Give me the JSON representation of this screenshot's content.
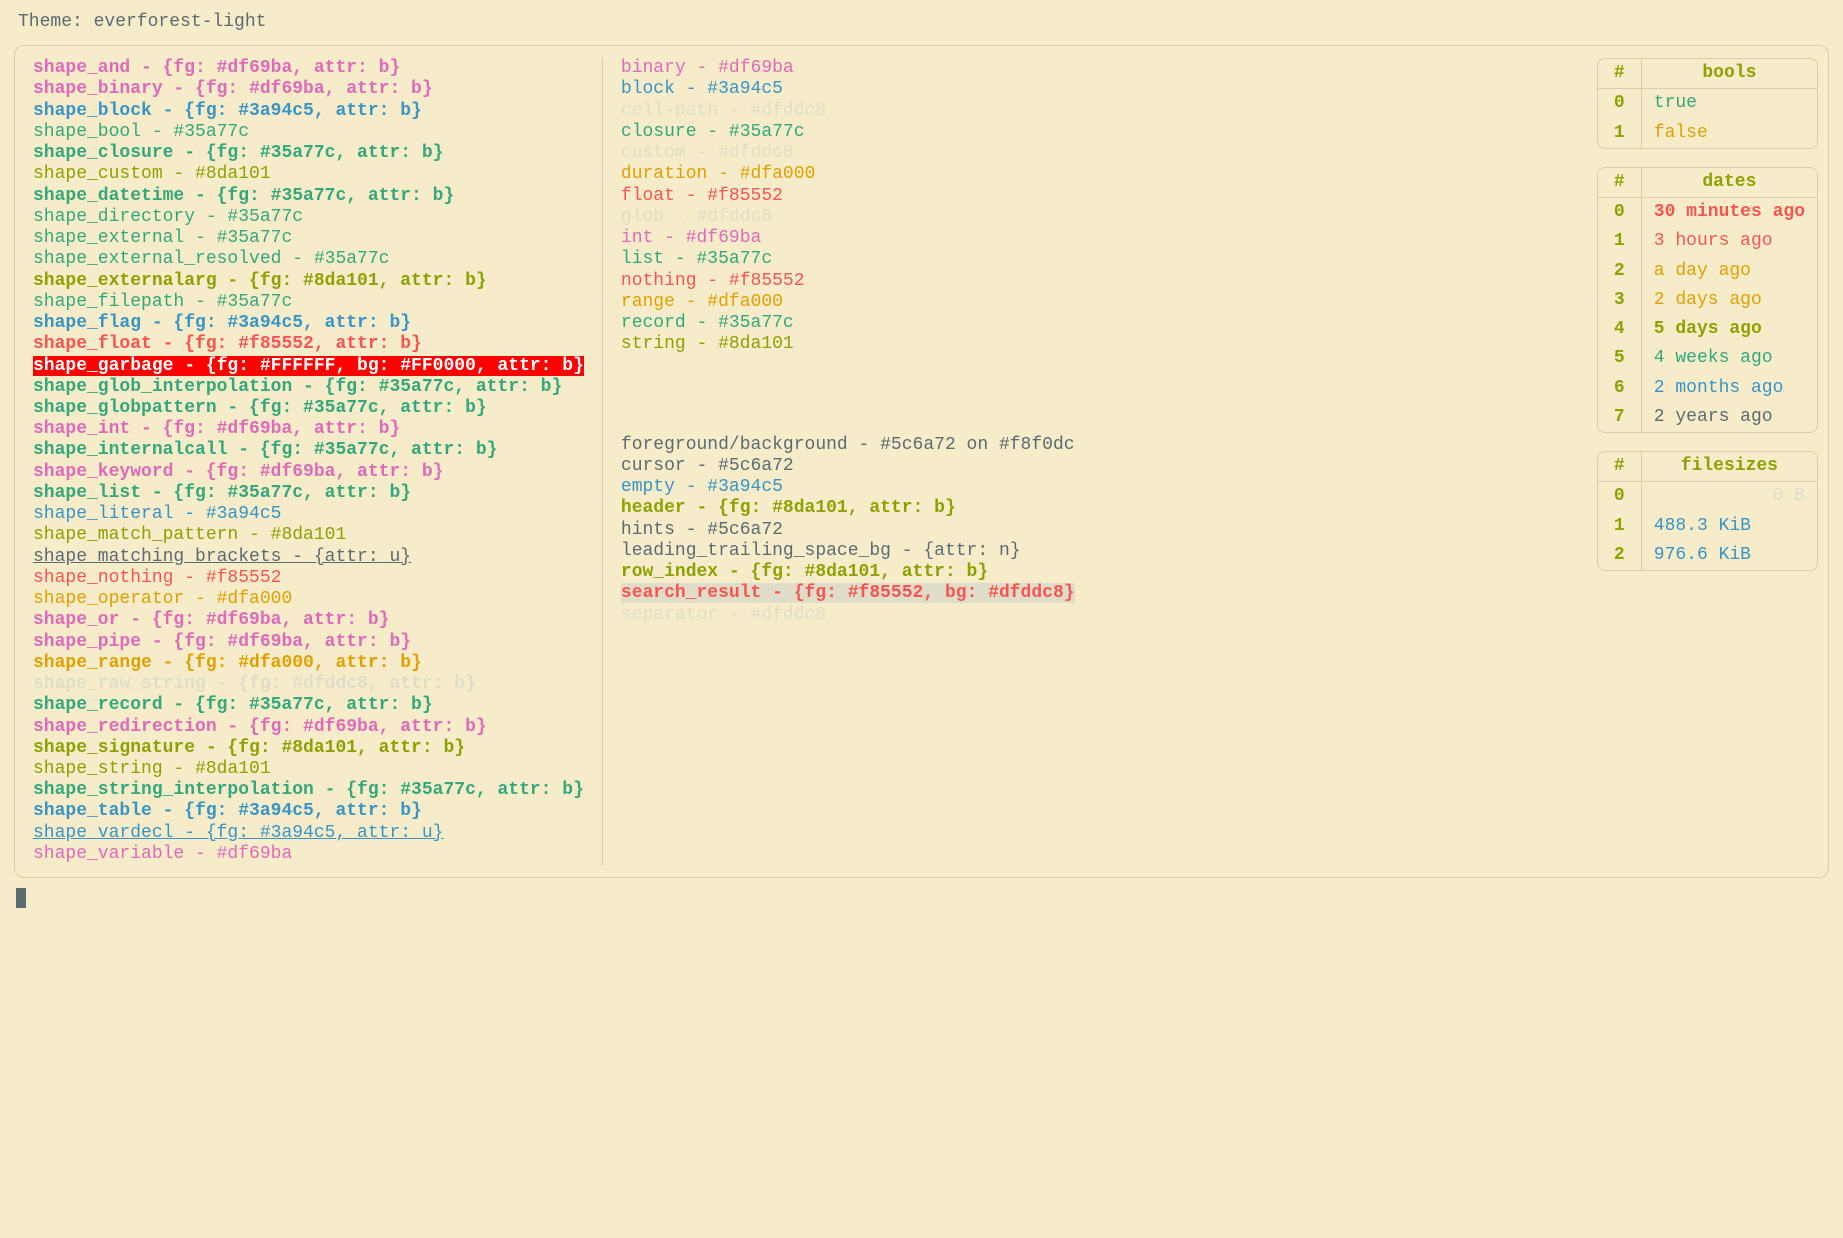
{
  "title": "Theme: everforest-light",
  "colors": {
    "fg": "#5c6a72",
    "bg": "#f8f0dc",
    "green": "#35a77c",
    "olive": "#8da101",
    "orange": "#dfa000",
    "red": "#f85552",
    "pink": "#df69ba",
    "blue": "#3a94c5",
    "dim": "#dfddc8"
  },
  "shapes": [
    {
      "name": "shape_and",
      "val": "{fg: #df69ba, attr: b}",
      "color": "pink",
      "bold": true
    },
    {
      "name": "shape_binary",
      "val": "{fg: #df69ba, attr: b}",
      "color": "pink",
      "bold": true
    },
    {
      "name": "shape_block",
      "val": "{fg: #3a94c5, attr: b}",
      "color": "blue",
      "bold": true
    },
    {
      "name": "shape_bool",
      "val": "#35a77c",
      "color": "green"
    },
    {
      "name": "shape_closure",
      "val": "{fg: #35a77c, attr: b}",
      "color": "green",
      "bold": true
    },
    {
      "name": "shape_custom",
      "val": "#8da101",
      "color": "olive"
    },
    {
      "name": "shape_datetime",
      "val": "{fg: #35a77c, attr: b}",
      "color": "green",
      "bold": true
    },
    {
      "name": "shape_directory",
      "val": "#35a77c",
      "color": "green"
    },
    {
      "name": "shape_external",
      "val": "#35a77c",
      "color": "green"
    },
    {
      "name": "shape_external_resolved",
      "val": "#35a77c",
      "color": "green"
    },
    {
      "name": "shape_externalarg",
      "val": "{fg: #8da101, attr: b}",
      "color": "olive",
      "bold": true
    },
    {
      "name": "shape_filepath",
      "val": "#35a77c",
      "color": "green"
    },
    {
      "name": "shape_flag",
      "val": "{fg: #3a94c5, attr: b}",
      "color": "blue",
      "bold": true
    },
    {
      "name": "shape_float",
      "val": "{fg: #f85552, attr: b}",
      "color": "red",
      "bold": true
    },
    {
      "name": "shape_garbage",
      "val": "{fg: #FFFFFF, bg: #FF0000, attr: b}",
      "garbage": true
    },
    {
      "name": "shape_glob_interpolation",
      "val": "{fg: #35a77c, attr: b}",
      "color": "green",
      "bold": true
    },
    {
      "name": "shape_globpattern",
      "val": "{fg: #35a77c, attr: b}",
      "color": "green",
      "bold": true
    },
    {
      "name": "shape_int",
      "val": "{fg: #df69ba, attr: b}",
      "color": "pink",
      "bold": true
    },
    {
      "name": "shape_internalcall",
      "val": "{fg: #35a77c, attr: b}",
      "color": "green",
      "bold": true
    },
    {
      "name": "shape_keyword",
      "val": "{fg: #df69ba, attr: b}",
      "color": "pink",
      "bold": true
    },
    {
      "name": "shape_list",
      "val": "{fg: #35a77c, attr: b}",
      "color": "green",
      "bold": true
    },
    {
      "name": "shape_literal",
      "val": "#3a94c5",
      "color": "blue"
    },
    {
      "name": "shape_match_pattern",
      "val": "#8da101",
      "color": "olive"
    },
    {
      "name": "shape_matching_brackets",
      "val": "{attr: u}",
      "color": "fg",
      "underline": true
    },
    {
      "name": "shape_nothing",
      "val": "#f85552",
      "color": "red"
    },
    {
      "name": "shape_operator",
      "val": "#dfa000",
      "color": "orange"
    },
    {
      "name": "shape_or",
      "val": "{fg: #df69ba, attr: b}",
      "color": "pink",
      "bold": true
    },
    {
      "name": "shape_pipe",
      "val": "{fg: #df69ba, attr: b}",
      "color": "pink",
      "bold": true
    },
    {
      "name": "shape_range",
      "val": "{fg: #dfa000, attr: b}",
      "color": "orange",
      "bold": true
    },
    {
      "name": "shape_raw_string",
      "val": "{fg: #dfddc8, attr: b}",
      "color": "dim",
      "bold": true
    },
    {
      "name": "shape_record",
      "val": "{fg: #35a77c, attr: b}",
      "color": "green",
      "bold": true
    },
    {
      "name": "shape_redirection",
      "val": "{fg: #df69ba, attr: b}",
      "color": "pink",
      "bold": true
    },
    {
      "name": "shape_signature",
      "val": "{fg: #8da101, attr: b}",
      "color": "olive",
      "bold": true
    },
    {
      "name": "shape_string",
      "val": "#8da101",
      "color": "olive"
    },
    {
      "name": "shape_string_interpolation",
      "val": "{fg: #35a77c, attr: b}",
      "color": "green",
      "bold": true
    },
    {
      "name": "shape_table",
      "val": "{fg: #3a94c5, attr: b}",
      "color": "blue",
      "bold": true
    },
    {
      "name": "shape_vardecl",
      "val": "{fg: #3a94c5, attr: u}",
      "color": "blue",
      "underline": true
    },
    {
      "name": "shape_variable",
      "val": "#df69ba",
      "color": "pink"
    }
  ],
  "types": [
    {
      "name": "binary",
      "val": "#df69ba",
      "color": "pink"
    },
    {
      "name": "block",
      "val": "#3a94c5",
      "color": "blue"
    },
    {
      "name": "cell-path",
      "val": "#dfddc8",
      "color": "dim"
    },
    {
      "name": "closure",
      "val": "#35a77c",
      "color": "green"
    },
    {
      "name": "custom",
      "val": "#dfddc8",
      "color": "dim"
    },
    {
      "name": "duration",
      "val": "#dfa000",
      "color": "orange"
    },
    {
      "name": "float",
      "val": "#f85552",
      "color": "red"
    },
    {
      "name": "glob",
      "val": "#dfddc8",
      "color": "dim"
    },
    {
      "name": "int",
      "val": "#df69ba",
      "color": "pink"
    },
    {
      "name": "list",
      "val": "#35a77c",
      "color": "green"
    },
    {
      "name": "nothing",
      "val": "#f85552",
      "color": "red"
    },
    {
      "name": "range",
      "val": "#dfa000",
      "color": "orange"
    },
    {
      "name": "record",
      "val": "#35a77c",
      "color": "green"
    },
    {
      "name": "string",
      "val": "#8da101",
      "color": "olive"
    }
  ],
  "misc": [
    {
      "name": "foreground/background",
      "val": "#5c6a72 on #f8f0dc",
      "color": "fg"
    },
    {
      "name": "cursor",
      "val": "#5c6a72",
      "color": "fg"
    },
    {
      "name": "empty",
      "val": "#3a94c5",
      "color": "blue"
    },
    {
      "name": "header",
      "val": "{fg: #8da101, attr: b}",
      "color": "olive",
      "bold": true
    },
    {
      "name": "hints",
      "val": "#5c6a72",
      "color": "fg"
    },
    {
      "name": "leading_trailing_space_bg",
      "val": "{attr: n}",
      "color": "fg"
    },
    {
      "name": "row_index",
      "val": "{fg: #8da101, attr: b}",
      "color": "olive",
      "bold": true
    },
    {
      "name": "search_result",
      "val": "{fg: #f85552, bg: #dfddc8}",
      "search": true
    },
    {
      "name": "separator",
      "val": "#dfddc8",
      "color": "dim"
    }
  ],
  "tables": {
    "bools": {
      "header": "bools",
      "rows": [
        {
          "i": "0",
          "v": "true",
          "color": "green"
        },
        {
          "i": "1",
          "v": "false",
          "color": "orange"
        }
      ]
    },
    "dates": {
      "header": "dates",
      "rows": [
        {
          "i": "0",
          "v": "30 minutes ago",
          "color": "red",
          "bold": true
        },
        {
          "i": "1",
          "v": "3 hours ago",
          "color": "red"
        },
        {
          "i": "2",
          "v": "a day ago",
          "color": "orange"
        },
        {
          "i": "3",
          "v": "2 days ago",
          "color": "orange"
        },
        {
          "i": "4",
          "v": "5 days ago",
          "color": "olive",
          "bold": true
        },
        {
          "i": "5",
          "v": "4 weeks ago",
          "color": "green"
        },
        {
          "i": "6",
          "v": "2 months ago",
          "color": "blue"
        },
        {
          "i": "7",
          "v": "2 years ago",
          "color": "fg"
        }
      ]
    },
    "filesizes": {
      "header": "filesizes",
      "rows": [
        {
          "i": "0",
          "v": "0 B",
          "color": "dim",
          "right": true
        },
        {
          "i": "1",
          "v": "488.3 KiB",
          "color": "blue"
        },
        {
          "i": "2",
          "v": "976.6 KiB",
          "color": "blue"
        }
      ]
    }
  }
}
